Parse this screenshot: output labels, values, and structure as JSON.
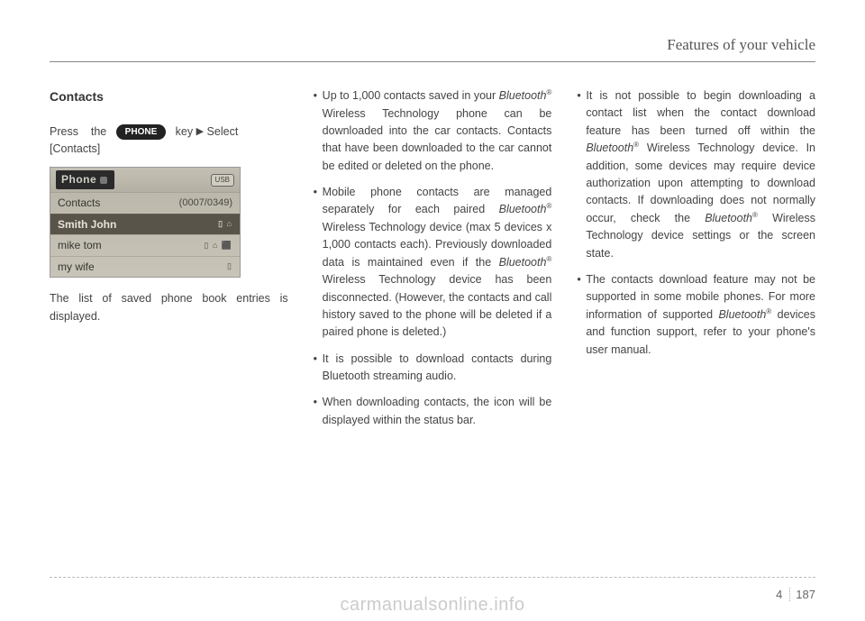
{
  "header": {
    "title": "Features of your vehicle"
  },
  "col1": {
    "title": "Contacts",
    "press_word1": "Press",
    "press_word2": "the",
    "phone_key": "PHONE",
    "press_word3": "key",
    "select_word": "Select",
    "contacts_bracket": "[Contacts]",
    "caption": "The list of saved phone book entries is displayed."
  },
  "screenshot": {
    "phone_label": "Phone",
    "usb": "USB",
    "contacts_label": "Contacts",
    "contacts_count": "(0007/0349)",
    "row1": "Smith John",
    "row2": "mike tom",
    "row3": "my wife"
  },
  "col2": {
    "b1a": "Up to 1,000 contacts saved in your ",
    "b1b": "Bluetooth",
    "b1c": " Wireless Technology phone can be downloaded into the car contacts. Contacts that have been downloaded to the car cannot be edited or deleted on the phone.",
    "b2a": "Mobile phone contacts are managed separately for each paired ",
    "b2b": "Bluetooth",
    "b2c": " Wireless Technology device (max 5 devices x 1,000 contacts each). Previously downloaded data is maintained even if the ",
    "b2d": "Bluetooth",
    "b2e": " Wireless Technology device has been disconnected. (However, the contacts and call history saved to the phone will be deleted if a paired phone is deleted.)",
    "b3": "It is possible to download contacts during Bluetooth streaming audio.",
    "b4": "When downloading contacts, the icon will be displayed within the status bar."
  },
  "col3": {
    "b1a": "It is not possible to begin downloading a contact list when the contact download feature has been turned off within the ",
    "b1b": "Bluetooth",
    "b1c": " Wireless Technology device. In addition, some devices may require device authorization upon attempting to download contacts. If downloading does not normally occur, check the ",
    "b1d": "Bluetooth",
    "b1e": " Wireless Technology device settings or the screen state.",
    "b2a": "The contacts download feature may not be supported in some mobile phones. For more information of supported ",
    "b2b": "Bluetooth",
    "b2c": " devices and function support, refer to your phone's user manual."
  },
  "footer": {
    "chapter": "4",
    "page": "187"
  },
  "watermark": "carmanualsonline.info",
  "reg": "®"
}
